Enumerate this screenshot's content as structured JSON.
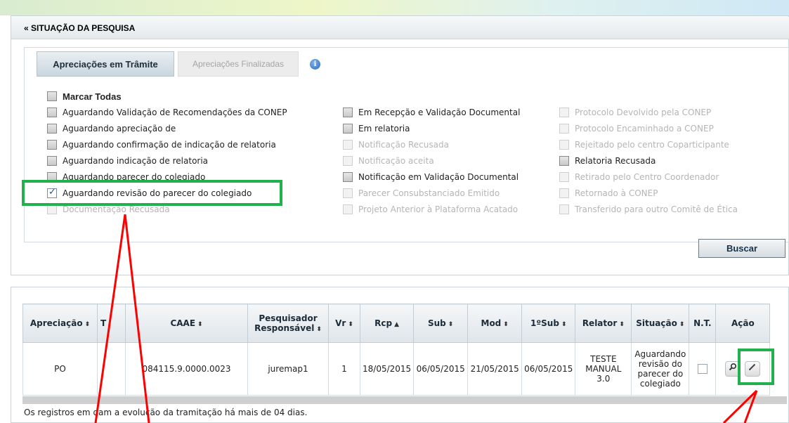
{
  "panel": {
    "toggle": "«",
    "title": "SITUAÇÃO DA PESQUISA"
  },
  "tabs": [
    {
      "label": "Apreciações em Trâmite",
      "active": true
    },
    {
      "label": "Apreciações Finalizadas",
      "active": false
    }
  ],
  "info_icon": "i",
  "filters": {
    "mark_all": "Marcar Todas",
    "col1": [
      {
        "label": "Aguardando Validação de Recomendações da CONEP",
        "checked": false,
        "enabled": true
      },
      {
        "label": "Aguardando apreciação de",
        "checked": false,
        "enabled": true
      },
      {
        "label": "Aguardando confirmação de indicação de relatoria",
        "checked": false,
        "enabled": true
      },
      {
        "label": "Aguardando indicação de relatoria",
        "checked": false,
        "enabled": true
      },
      {
        "label": "Aguardando parecer do colegiado",
        "checked": false,
        "enabled": true
      },
      {
        "label": "Aguardando revisão do parecer do colegiado",
        "checked": true,
        "enabled": true
      },
      {
        "label": "Documentação Recusada",
        "checked": false,
        "enabled": false
      }
    ],
    "col2": [
      {
        "label": "Em Recepção e Validação Documental",
        "checked": false,
        "enabled": true
      },
      {
        "label": "Em relatoria",
        "checked": false,
        "enabled": true
      },
      {
        "label": "Notificação Recusada",
        "checked": false,
        "enabled": false
      },
      {
        "label": "Notificação aceita",
        "checked": false,
        "enabled": false
      },
      {
        "label": "Notificação em Validação Documental",
        "checked": false,
        "enabled": true
      },
      {
        "label": "Parecer Consubstanciado Emitido",
        "checked": false,
        "enabled": false
      },
      {
        "label": "Projeto Anterior à Plataforma Acatado",
        "checked": false,
        "enabled": false
      }
    ],
    "col3": [
      {
        "label": "Protocolo Devolvido pela CONEP",
        "checked": false,
        "enabled": false
      },
      {
        "label": "Protocolo Encaminhado a CONEP",
        "checked": false,
        "enabled": false
      },
      {
        "label": "Rejeitado pelo centro Coparticipante",
        "checked": false,
        "enabled": false
      },
      {
        "label": "Relatoria Recusada",
        "checked": false,
        "enabled": true
      },
      {
        "label": "Retirado pelo Centro Coordenador",
        "checked": false,
        "enabled": false
      },
      {
        "label": "Retornado à CONEP",
        "checked": false,
        "enabled": false
      },
      {
        "label": "Transferido para outro Comitê de Ética",
        "checked": false,
        "enabled": false
      }
    ]
  },
  "search_button": "Buscar",
  "table": {
    "headers": {
      "apreciacao": "Apreciação",
      "t": "T",
      "caae": "CAAE",
      "pesquisador_1": "Pesquisador",
      "pesquisador_2": "Responsável",
      "vr": "Vr",
      "rcp": "Rcp",
      "sub": "Sub",
      "mod": "Mod",
      "first_sub": "1ºSub",
      "relator": "Relator",
      "situacao": "Situação",
      "nt": "N.T.",
      "acao": "Ação"
    },
    "sort_icon": "⬍",
    "sort_up_icon": "▲",
    "rows": [
      {
        "apreciacao": "PO",
        "caae": "084115.9.0000.0023",
        "pesquisador": "juremap1",
        "vr": "1",
        "rcp": "18/05/2015",
        "sub": "06/05/2015",
        "mod": "21/05/2015",
        "first_sub": "06/05/2015",
        "relator": [
          "TESTE",
          "MANUAL",
          "3.0"
        ],
        "situacao": [
          "Aguardando",
          "revisão do",
          "parecer do",
          "colegiado"
        ]
      }
    ]
  },
  "footnote": "Os registros em dam a evolução da tramitação há mais de 04 dias.",
  "colors": {
    "annotation_green": "#22b14c",
    "annotation_red": "#ff0000"
  }
}
